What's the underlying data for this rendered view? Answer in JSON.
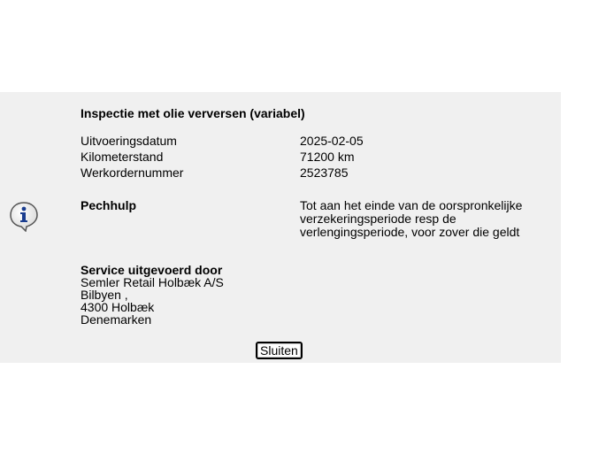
{
  "dialog": {
    "title": "Inspectie met olie verversen (variabel)",
    "icon": "info-icon",
    "details": [
      {
        "label": "Uitvoeringsdatum",
        "value": "2025-02-05"
      },
      {
        "label": "Kilometerstand",
        "value": "71200 km"
      },
      {
        "label": "Werkordernummer",
        "value": "2523785"
      }
    ],
    "pechhulp": {
      "label": "Pechhulp",
      "value": "Tot aan het einde van de oorspronkelijke verzekeringsperiode resp de verlengingsperiode, voor zover die geldt"
    },
    "service": {
      "heading": "Service uitgevoerd door",
      "lines": [
        "Semler Retail Holbæk A/S",
        "Bilbyen ,",
        "4300 Holbæk",
        "Denemarken"
      ]
    },
    "close_label": "Sluiten"
  },
  "colors": {
    "panel_background": "#f0f0f0",
    "icon_blue": "#1a3d8f"
  }
}
